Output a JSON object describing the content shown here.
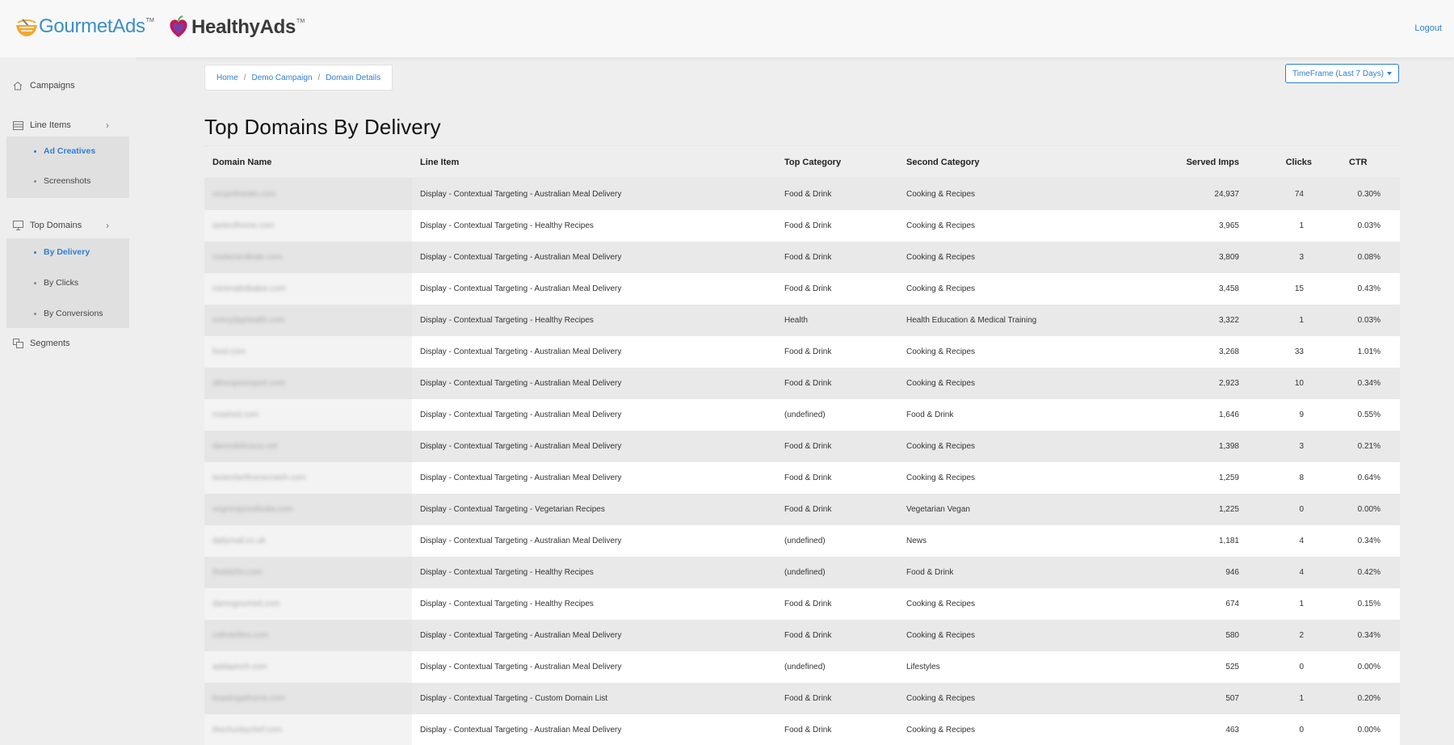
{
  "header": {
    "brand1": "GourmetAds",
    "brand2": "HealthyAds",
    "tm": "TM",
    "logout": "Logout"
  },
  "sidebar": {
    "campaigns": "Campaigns",
    "line_items": "Line Items",
    "line_items_sub": [
      "Ad Creatives",
      "Screenshots"
    ],
    "top_domains": "Top Domains",
    "top_domains_sub": [
      "By Delivery",
      "By Clicks",
      "By Conversions"
    ],
    "segments": "Segments"
  },
  "breadcrumb": [
    "Home",
    "Demo Campaign",
    "Domain Details"
  ],
  "timeframe": "TimeFrame (Last 7 Days)",
  "page_title": "Top Domains By Delivery",
  "table": {
    "headers": [
      "Domain Name",
      "Line Item",
      "Top Category",
      "Second Category",
      "Served Imps",
      "Clicks",
      "CTR"
    ],
    "rows": [
      [
        "recipetineats.com",
        "Display - Contextual Targeting - Australian Meal Delivery",
        "Food & Drink",
        "Cooking & Recipes",
        "24,937",
        "74",
        "0.30%"
      ],
      [
        "tasteofhome.com",
        "Display - Contextual Targeting - Healthy Recipes",
        "Food & Drink",
        "Cooking & Recipes",
        "3,965",
        "1",
        "0.03%"
      ],
      [
        "cookieandkate.com",
        "Display - Contextual Targeting - Australian Meal Delivery",
        "Food & Drink",
        "Cooking & Recipes",
        "3,809",
        "3",
        "0.08%"
      ],
      [
        "minimalistbaker.com",
        "Display - Contextual Targeting - Australian Meal Delivery",
        "Food & Drink",
        "Cooking & Recipes",
        "3,458",
        "15",
        "0.43%"
      ],
      [
        "everydayhealth.com",
        "Display - Contextual Targeting - Healthy Recipes",
        "Health",
        "Health Education & Medical Training",
        "3,322",
        "1",
        "0.03%"
      ],
      [
        "food.com",
        "Display - Contextual Targeting - Australian Meal Delivery",
        "Food & Drink",
        "Cooking & Recipes",
        "3,268",
        "33",
        "1.01%"
      ],
      [
        "allrecipesreport.com",
        "Display - Contextual Targeting - Australian Meal Delivery",
        "Food & Drink",
        "Cooking & Recipes",
        "2,923",
        "10",
        "0.34%"
      ],
      [
        "mashed.com",
        "Display - Contextual Targeting - Australian Meal Delivery",
        "(undefined)",
        "Food & Drink",
        "1,646",
        "9",
        "0.55%"
      ],
      [
        "damndelicious.net",
        "Display - Contextual Targeting - Australian Meal Delivery",
        "Food & Drink",
        "Cooking & Recipes",
        "1,398",
        "3",
        "0.21%"
      ],
      [
        "tasteofartfromscratch.com",
        "Display - Contextual Targeting - Australian Meal Delivery",
        "Food & Drink",
        "Cooking & Recipes",
        "1,259",
        "8",
        "0.64%"
      ],
      [
        "vegrecipesofindia.com",
        "Display - Contextual Targeting - Vegetarian Recipes",
        "Food & Drink",
        "Vegetarian Vegan",
        "1,225",
        "0",
        "0.00%"
      ],
      [
        "dailymail.co.uk",
        "Display - Contextual Targeting - Australian Meal Delivery",
        "(undefined)",
        "News",
        "1,181",
        "4",
        "0.34%"
      ],
      [
        "thekitchn.com",
        "Display - Contextual Targeting - Healthy Recipes",
        "(undefined)",
        "Food & Drink",
        "946",
        "4",
        "0.42%"
      ],
      [
        "damngourmet.com",
        "Display - Contextual Targeting - Healthy Recipes",
        "Food & Drink",
        "Cooking & Recipes",
        "674",
        "1",
        "0.15%"
      ],
      [
        "cafedelites.com",
        "Display - Contextual Targeting - Australian Meal Delivery",
        "Food & Drink",
        "Cooking & Recipes",
        "580",
        "2",
        "0.34%"
      ],
      [
        "addapinch.com",
        "Display - Contextual Targeting - Australian Meal Delivery",
        "(undefined)",
        "Lifestyles",
        "525",
        "0",
        "0.00%"
      ],
      [
        "feastingathome.com",
        "Display - Contextual Targeting - Custom Domain List",
        "Food & Drink",
        "Cooking & Recipes",
        "507",
        "1",
        "0.20%"
      ],
      [
        "thechunkychef.com",
        "Display - Contextual Targeting - Australian Meal Delivery",
        "Food & Drink",
        "Cooking & Recipes",
        "463",
        "0",
        "0.00%"
      ]
    ]
  }
}
